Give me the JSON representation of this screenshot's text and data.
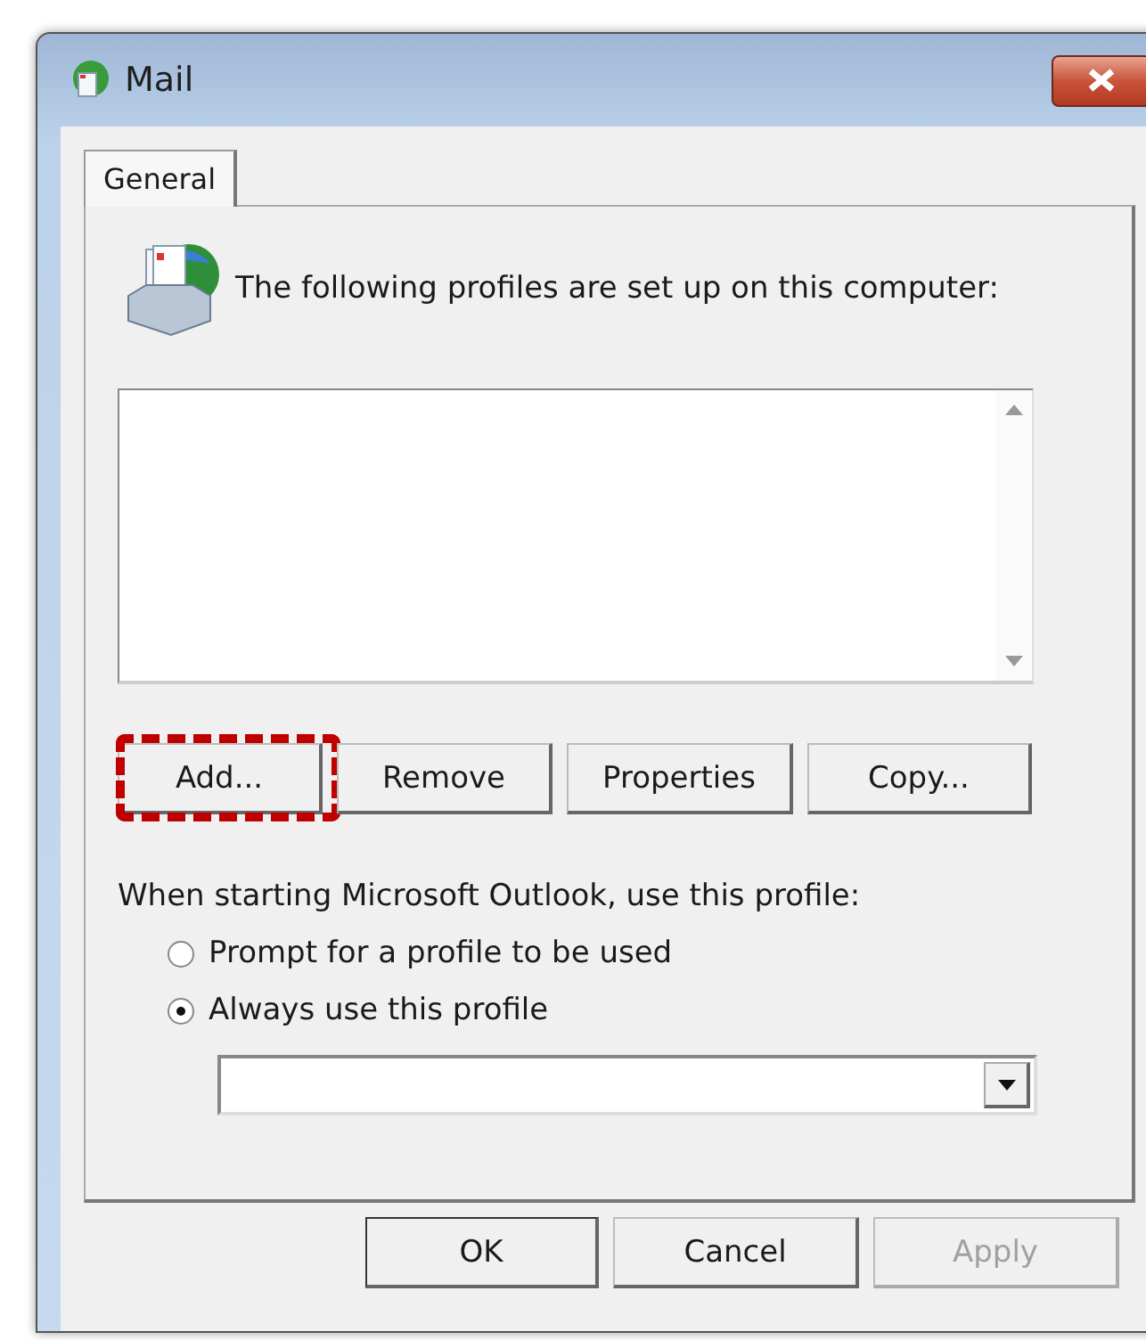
{
  "window": {
    "title": "Mail"
  },
  "tabs": [
    {
      "label": "General",
      "selected": true
    }
  ],
  "intro": "The following profiles are set up on this computer:",
  "profile_buttons": [
    {
      "label": "Add...",
      "highlighted": true
    },
    {
      "label": "Remove",
      "highlighted": false
    },
    {
      "label": "Properties",
      "highlighted": false
    },
    {
      "label": "Copy...",
      "highlighted": false
    }
  ],
  "startup_label": "When starting Microsoft Outlook, use this profile:",
  "options": [
    {
      "label": "Prompt for a profile to be used",
      "selected": false
    },
    {
      "label": "Always use this profile",
      "selected": true
    }
  ],
  "footer_buttons": [
    {
      "label": "OK",
      "disabled": false,
      "default": true
    },
    {
      "label": "Cancel",
      "disabled": false,
      "default": false
    },
    {
      "label": "Apply",
      "disabled": true,
      "default": false
    }
  ]
}
